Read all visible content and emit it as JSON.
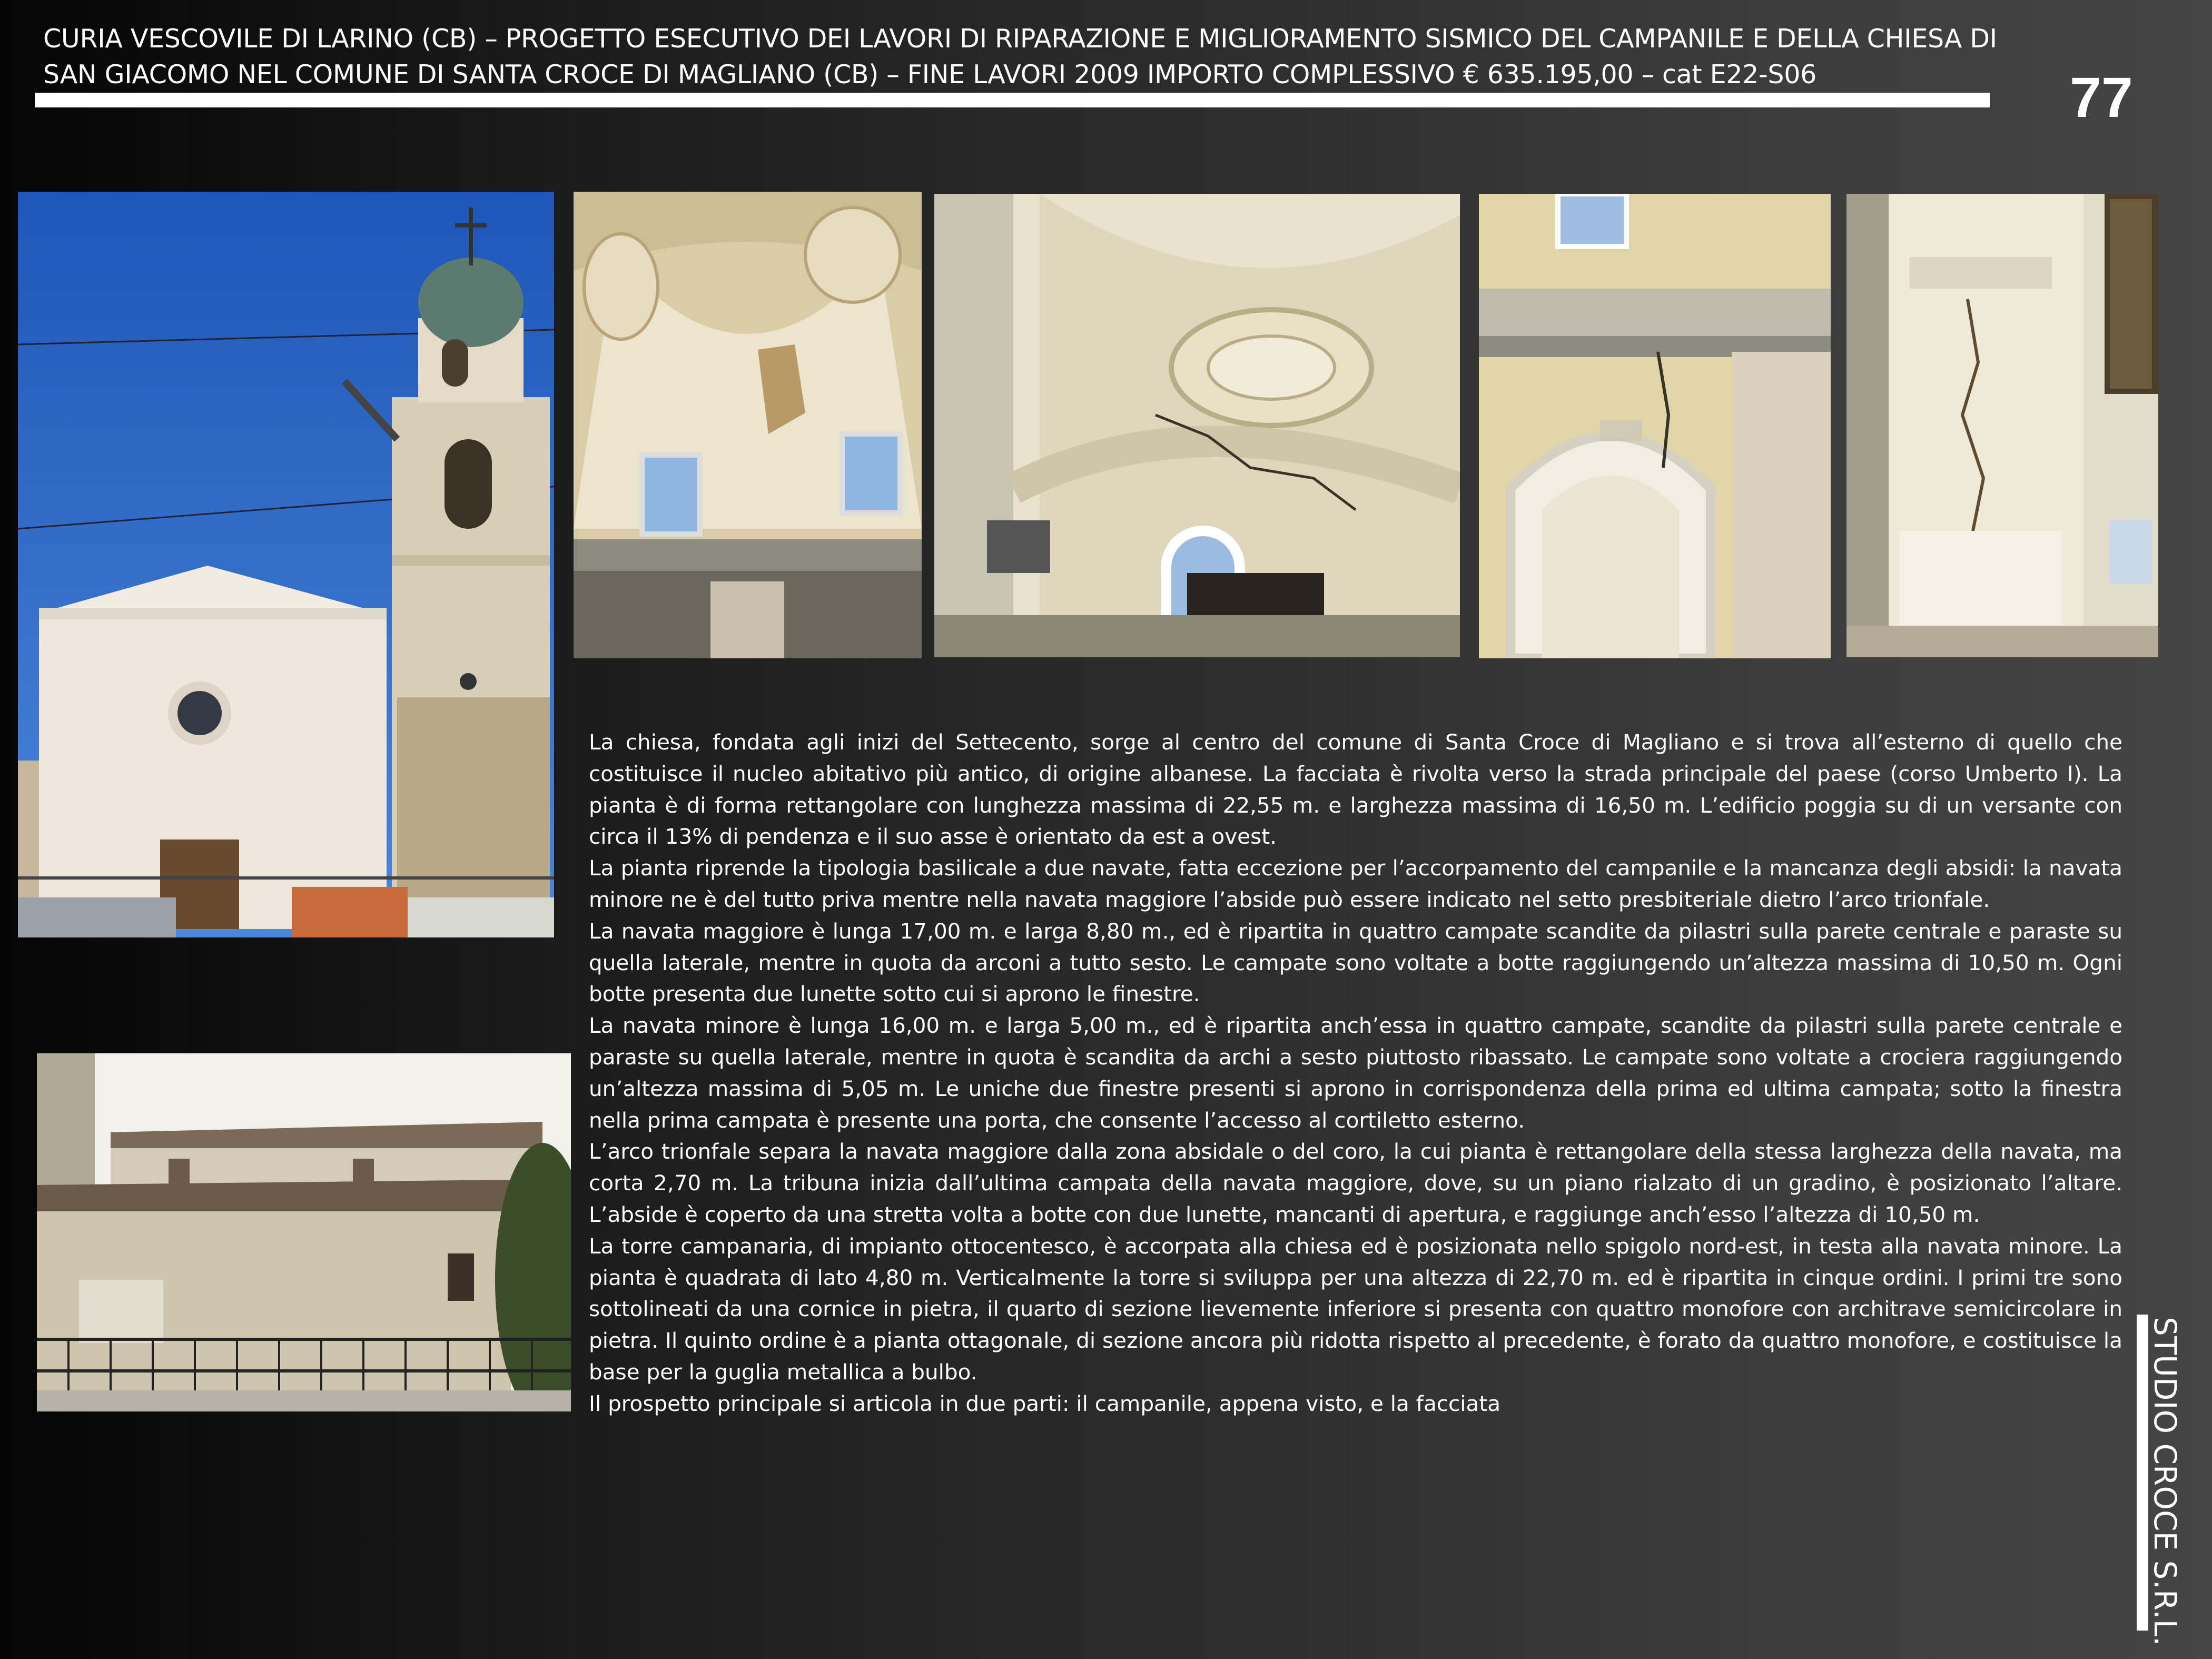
{
  "header": {
    "line1": "CURIA VESCOVILE DI LARINO (CB) – PROGETTO ESECUTIVO DEI LAVORI DI RIPARAZIONE E MIGLIORAMENTO SISMICO DEL CAMPANILE E DELLA CHIESA DI",
    "line2": "SAN GIACOMO NEL COMUNE DI  SANTA CROCE DI MAGLIANO (CB) – FINE LAVORI 2009 IMPORTO COMPLESSIVO € 635.195,00 – cat E22-S06"
  },
  "page_number": "77",
  "studio": "STUDIO CROCE S.R.L.",
  "paragraphs": [
    "La chiesa, fondata agli inizi del Settecento, sorge al centro del comune di Santa Croce di Magliano e si trova all’esterno di quello che costituisce il nucleo abitativo più antico, di origine albanese. La facciata è rivolta verso la strada principale del paese (corso Umberto I). La pianta è di forma rettangolare con lunghezza massima di 22,55 m. e larghezza massima di 16,50 m. L’edificio poggia su di un versante con circa il 13% di pendenza e il suo asse è orientato da est a ovest.",
    "La pianta riprende la tipologia basilicale a due navate, fatta eccezione per l’accorpamento del campanile e la mancanza degli absidi: la navata minore ne è del tutto priva mentre nella navata maggiore l’abside può essere indicato nel setto presbiteriale dietro l’arco trionfale.",
    "La navata maggiore è lunga 17,00 m. e larga 8,80 m., ed è ripartita in quattro campate scandite da pilastri sulla parete centrale e paraste su quella laterale, mentre in quota da arconi a tutto sesto. Le campate sono voltate a botte raggiungendo un’altezza massima di 10,50 m. Ogni botte presenta due lunette sotto cui si aprono le finestre.",
    "La navata minore è lunga 16,00 m. e larga 5,00 m., ed è ripartita anch’essa in quattro campate, scandite da pilastri sulla parete centrale e paraste su quella laterale, mentre in quota è scandita da archi a sesto piuttosto ribassato. Le campate sono voltate a crociera raggiungendo un’altezza massima di 5,05 m. Le uniche due finestre presenti si aprono in corrispondenza della prima ed ultima campata; sotto la finestra nella prima campata è presente una porta, che consente l’accesso al cortiletto esterno.",
    "L’arco trionfale separa la navata maggiore dalla zona absidale o del coro, la cui pianta è rettangolare della stessa larghezza della navata, ma corta 2,70 m. La tribuna inizia dall’ultima campata della navata maggiore, dove, su un piano rialzato di un gradino, è posizionato l’altare. L’abside è coperto da una stretta volta a botte con due lunette, mancanti di apertura, e raggiunge anch’esso l’altezza di 10,50 m.",
    "La torre campanaria, di impianto ottocentesco, è accorpata alla chiesa ed è posizionata nello spigolo nord-est, in testa alla navata minore. La pianta è quadrata di lato 4,80 m. Verticalmente la torre si sviluppa per una altezza di 22,70 m. ed è ripartita in cinque ordini. I primi tre sono sottolineati da una cornice in pietra, il quarto di sezione lievemente inferiore si presenta con quattro monofore con architrave semicircolare in pietra. Il quinto ordine è a pianta ottagonale, di sezione ancora più ridotta rispetto al precedente, è forato da quattro monofore, e costituisce la base per la guglia metallica a bulbo.",
    "Il prospetto principale si articola in due parti: il campanile, appena visto, e la facciata"
  ]
}
